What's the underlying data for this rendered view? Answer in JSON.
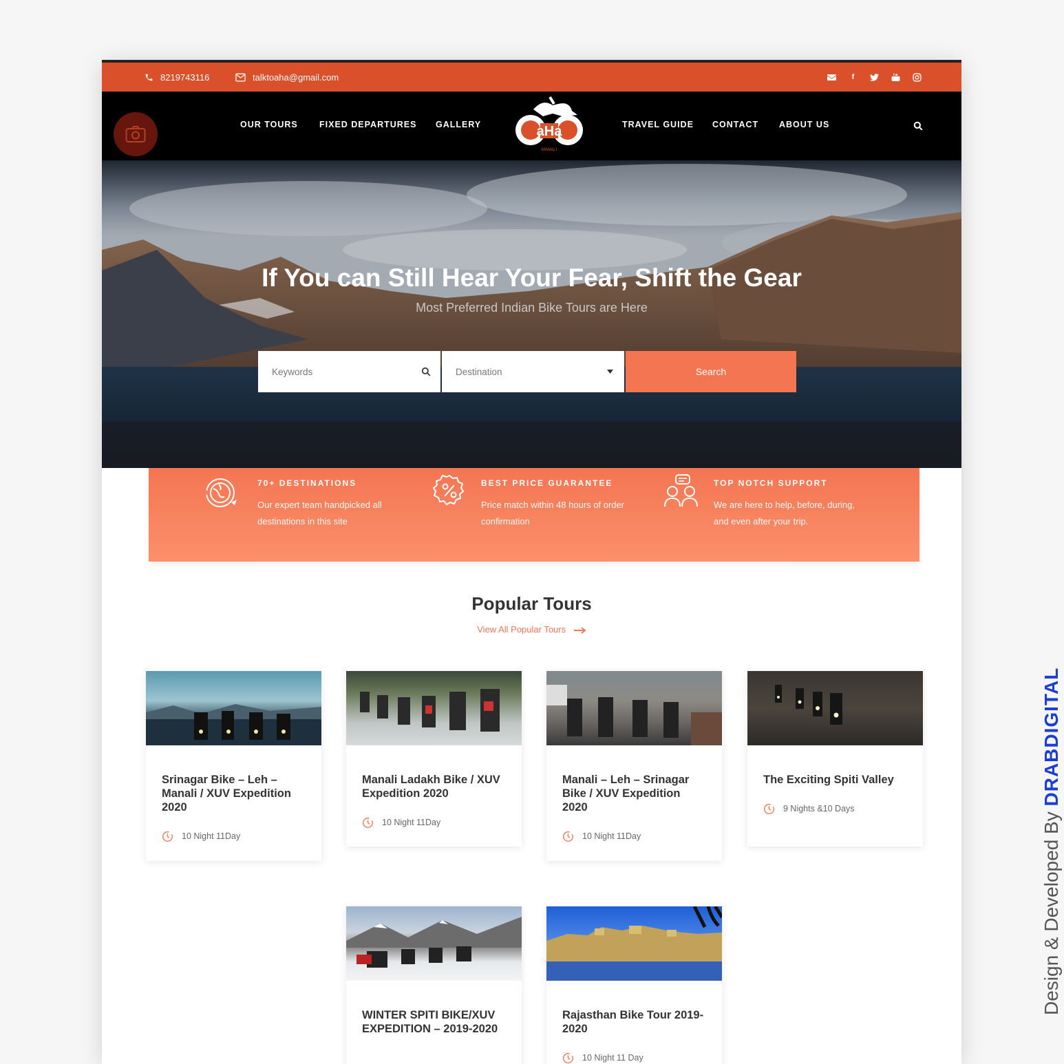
{
  "topbar": {
    "phone": "8219743116",
    "email": "talktoaha@gmail.com",
    "social_icons": [
      "mail-icon",
      "facebook-icon",
      "twitter-icon",
      "youtube-icon",
      "instagram-icon"
    ]
  },
  "nav": {
    "items": [
      "OUR TOURS",
      "FIXED DEPARTURES",
      "GALLERY",
      "TRAVEL GUIDE",
      "CONTACT",
      "ABOUT US"
    ],
    "logo_text": "aHa",
    "logo_sub": "MANALI"
  },
  "hero": {
    "title": "If You can Still Hear Your Fear, Shift the Gear",
    "subtitle": "Most Preferred Indian Bike Tours are Here",
    "keywords_placeholder": "Keywords",
    "destination_placeholder": "Destination",
    "search_label": "Search"
  },
  "features": [
    {
      "title": "70+ DESTINATIONS",
      "text": "Our expert team handpicked all destinations in this site",
      "icon": "globe-icon"
    },
    {
      "title": "BEST PRICE GUARANTEE",
      "text": "Price match within 48 hours of order confirmation",
      "icon": "percent-badge-icon"
    },
    {
      "title": "TOP NOTCH SUPPORT",
      "text": "We are here to help, before, during, and even after your trip.",
      "icon": "support-icon"
    }
  ],
  "popular": {
    "title": "Popular Tours",
    "link": "View All Popular Tours"
  },
  "tours": [
    {
      "title": "Srinagar Bike – Leh – Manali / XUV Expedition 2020",
      "duration": "10 Night 11Day"
    },
    {
      "title": "Manali Ladakh Bike / XUV Expedition 2020",
      "duration": "10 Night 11Day"
    },
    {
      "title": "Manali – Leh – Srinagar Bike / XUV Expedition 2020",
      "duration": "10 Night 11Day"
    },
    {
      "title": "The Exciting Spiti Valley",
      "duration": "9 Nights &10 Days"
    },
    {
      "title": "WINTER SPITI BIKE/XUV EXPEDITION – 2019-2020",
      "duration": ""
    },
    {
      "title": "Rajasthan Bike Tour 2019-2020",
      "duration": "10 Night 11 Day"
    }
  ],
  "credit": {
    "prefix": "Design & Developed By",
    "brand": "DRABDIGITAL"
  },
  "colors": {
    "accent": "#d9502a",
    "button": "#f47552",
    "dark": "#000000",
    "credit": "#1b3fd6"
  }
}
